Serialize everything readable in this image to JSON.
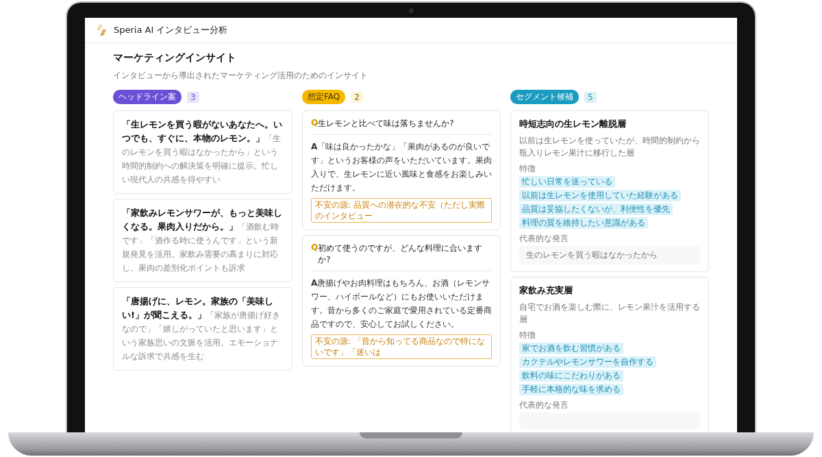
{
  "app": {
    "title": "Speria AI インタビュー分析"
  },
  "page": {
    "title": "マーケティングインサイト",
    "subtitle": "インタビューから導出されたマーケティング活用のためのインサイト"
  },
  "columns": [
    {
      "kind": "headline",
      "label": "ヘッドライン案",
      "count": "3",
      "color": "#6b4fd6",
      "items": [
        {
          "headline": "「生レモンを買う暇がないあなたへ。いつでも、すぐに、本物のレモン。」",
          "rationale": "「生のレモンを買う暇はなかったから」という時間的制約への解決策を明確に提示。忙しい現代人の共感を得やすい"
        },
        {
          "headline": "「家飲みレモンサワーが、もっと美味しくなる。果肉入りだから。」",
          "rationale": "「酒飲む時です」「酒作る時に使うんです」という新規発見を活用。家飲み需要の高まりに対応し、果肉の差別化ポイントも訴求"
        },
        {
          "headline": "「唐揚げに、レモン。家族の「美味しい!」が聞こえる。」",
          "rationale": "「家族が唐揚げ好きなので」「嬉しがっていたと思います」という家族思いの文脈を活用。エモーショナルな訴求で共感を生む"
        }
      ]
    },
    {
      "kind": "faq",
      "label": "想定FAQ",
      "count": "2",
      "color": "#f5b800",
      "items": [
        {
          "q_mark": "Q",
          "question": "生レモンと比べて味は落ちませんか?",
          "a_mark": "A",
          "answer": "「味は良かったかな」「果肉があるのが良いです」というお客様の声をいただいています。果肉入りで、生レモンに近い風味と食感をお楽しみいただけます。",
          "concern": "不安の源: 品質への潜在的な不安（ただし実際のインタビュー"
        },
        {
          "q_mark": "Q",
          "question": "初めて使うのですが、どんな料理に合いますか?",
          "a_mark": "A",
          "answer": "唐揚げやお肉料理はもちろん、お酒（レモンサワー、ハイボールなど）にもお使いいただけます。昔から多くのご家庭で愛用されている定番商品ですので、安心してお試しください。",
          "concern": "不安の源: 「昔から知ってる商品なので特にないです」「迷いは"
        }
      ]
    },
    {
      "kind": "segment",
      "label": "セグメント候補",
      "count": "5",
      "color": "#1a9cc0",
      "items": [
        {
          "title": "時短志向の生レモン離脱層",
          "description": "以前は生レモンを使っていたが、時間的制約から瓶入りレモン果汁に移行した層",
          "traits_label": "特徴",
          "traits": [
            "忙しい日常を送っている",
            "以前は生レモンを使用していた経験がある",
            "品質は妥協したくないが、利便性を優先",
            "料理の質を維持したい意識がある"
          ],
          "quote_label": "代表的な発言",
          "quote": "生のレモンを買う暇はなかったから"
        },
        {
          "title": "家飲み充実層",
          "description": "自宅でお酒を楽しむ際に、レモン果汁を活用する層",
          "traits_label": "特徴",
          "traits": [
            "家でお酒を飲む習慣がある",
            "カクテルやレモンサワーを自作する",
            "飲料の味にこだわりがある",
            "手軽に本格的な味を求める"
          ],
          "quote_label": "代表的な発言"
        }
      ]
    }
  ]
}
